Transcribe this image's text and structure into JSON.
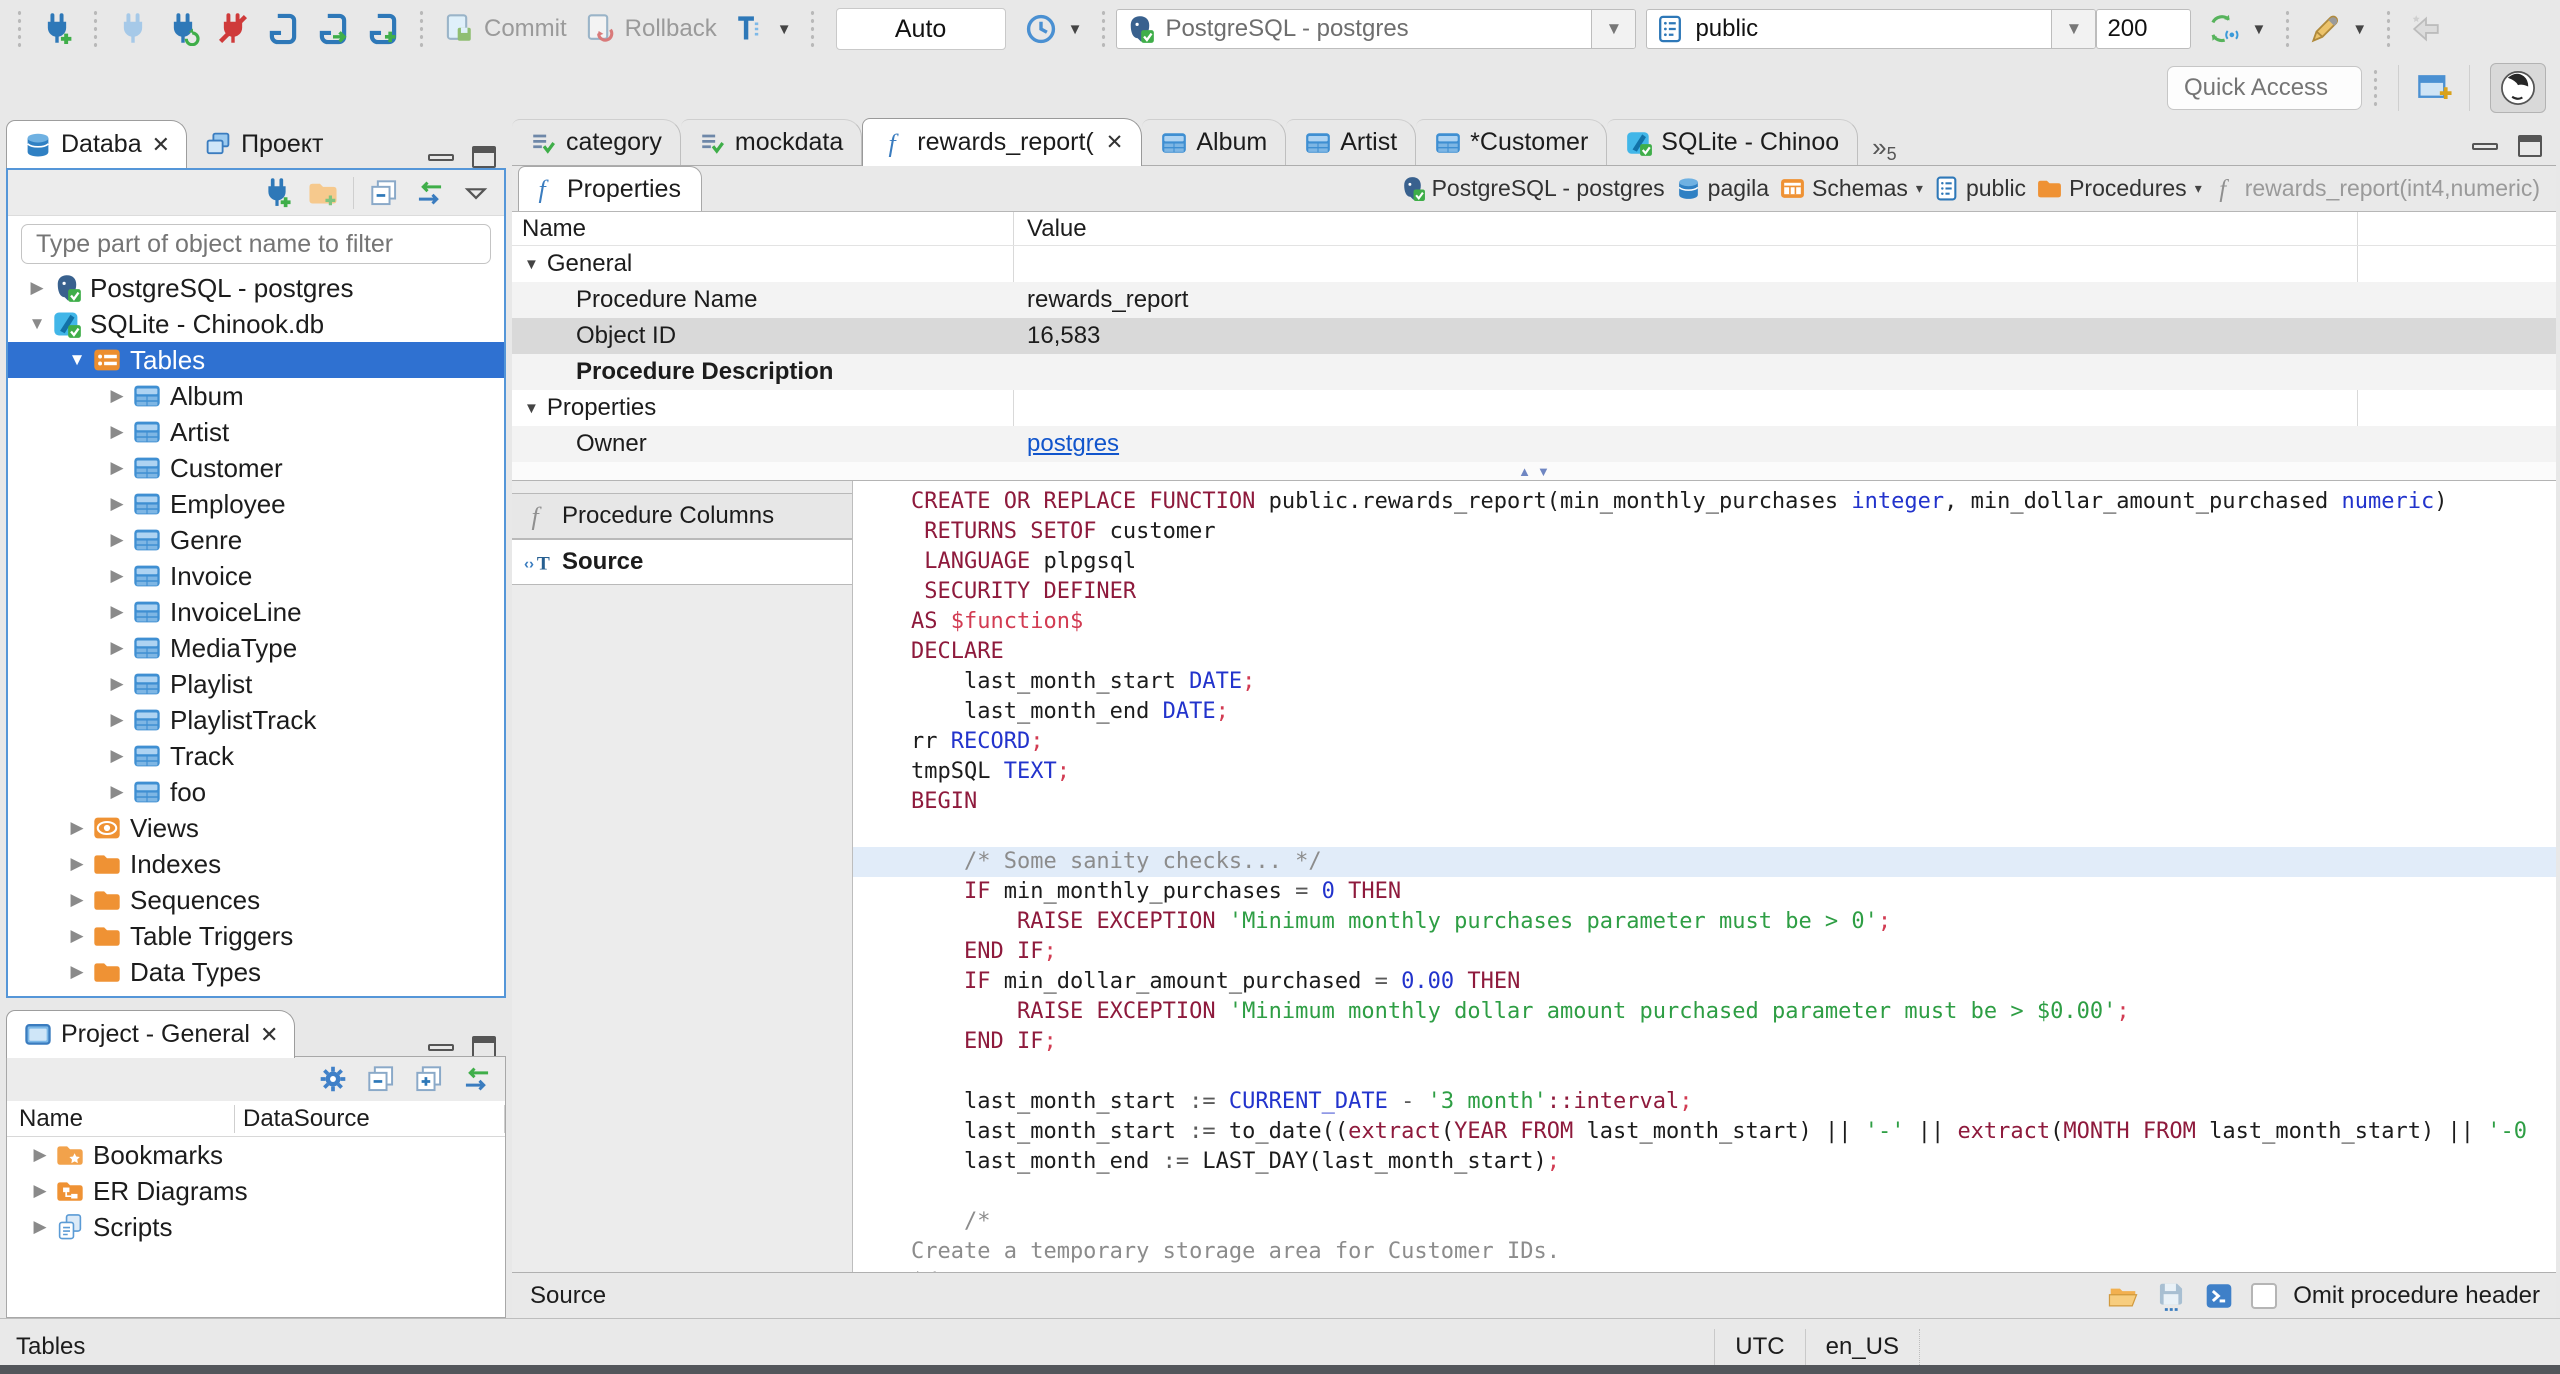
{
  "toolbar": {
    "commit": "Commit",
    "rollback": "Rollback",
    "auto": "Auto",
    "connection": "PostgreSQL - postgres",
    "schema": "public",
    "fetch_size": "200",
    "quick_access": "Quick Access"
  },
  "nav_panel": {
    "tabs": [
      {
        "label": "Databa",
        "icon": "db",
        "active": true,
        "close": true
      },
      {
        "label": "Проект",
        "icon": "windows"
      }
    ],
    "filter_placeholder": "Type part of object name to filter",
    "tree": [
      {
        "label": "PostgreSQL - postgres",
        "icon": "postgres",
        "indent": 0,
        "arrow": "collapsed"
      },
      {
        "label": "SQLite - Chinook.db",
        "icon": "sqlite",
        "indent": 0,
        "arrow": "expanded"
      },
      {
        "label": "Tables",
        "icon": "tables",
        "indent": 1,
        "arrow": "expanded",
        "selected": true
      },
      {
        "label": "Album",
        "icon": "table",
        "indent": 2,
        "arrow": "collapsed"
      },
      {
        "label": "Artist",
        "icon": "table",
        "indent": 2,
        "arrow": "collapsed"
      },
      {
        "label": "Customer",
        "icon": "table",
        "indent": 2,
        "arrow": "collapsed"
      },
      {
        "label": "Employee",
        "icon": "table",
        "indent": 2,
        "arrow": "collapsed"
      },
      {
        "label": "Genre",
        "icon": "table",
        "indent": 2,
        "arrow": "collapsed"
      },
      {
        "label": "Invoice",
        "icon": "table",
        "indent": 2,
        "arrow": "collapsed"
      },
      {
        "label": "InvoiceLine",
        "icon": "table",
        "indent": 2,
        "arrow": "collapsed"
      },
      {
        "label": "MediaType",
        "icon": "table",
        "indent": 2,
        "arrow": "collapsed"
      },
      {
        "label": "Playlist",
        "icon": "table",
        "indent": 2,
        "arrow": "collapsed"
      },
      {
        "label": "PlaylistTrack",
        "icon": "table",
        "indent": 2,
        "arrow": "collapsed"
      },
      {
        "label": "Track",
        "icon": "table",
        "indent": 2,
        "arrow": "collapsed"
      },
      {
        "label": "foo",
        "icon": "table",
        "indent": 2,
        "arrow": "collapsed"
      },
      {
        "label": "Views",
        "icon": "views",
        "indent": 1,
        "arrow": "collapsed"
      },
      {
        "label": "Indexes",
        "icon": "folder",
        "indent": 1,
        "arrow": "collapsed"
      },
      {
        "label": "Sequences",
        "icon": "folder",
        "indent": 1,
        "arrow": "collapsed"
      },
      {
        "label": "Table Triggers",
        "icon": "folder",
        "indent": 1,
        "arrow": "collapsed"
      },
      {
        "label": "Data Types",
        "icon": "folder",
        "indent": 1,
        "arrow": "collapsed"
      }
    ]
  },
  "project_panel": {
    "title": "Project - General",
    "columns": [
      "Name",
      "DataSource"
    ],
    "tree": [
      {
        "label": "Bookmarks",
        "icon": "bookmarks"
      },
      {
        "label": "ER Diagrams",
        "icon": "erd"
      },
      {
        "label": "Scripts",
        "icon": "scripts"
      }
    ]
  },
  "editor_tabs": [
    {
      "label": "category",
      "icon": "sqlscript"
    },
    {
      "label": "mockdata",
      "icon": "sqlscript"
    },
    {
      "label": "rewards_report(",
      "icon": "fn",
      "active": true,
      "close": true
    },
    {
      "label": "Album",
      "icon": "table"
    },
    {
      "label": "Artist",
      "icon": "table"
    },
    {
      "label": "*Customer",
      "icon": "table"
    },
    {
      "label": "SQLite - Chinoo",
      "icon": "sqlite"
    }
  ],
  "tab_overflow": "5",
  "properties": {
    "tab": "Properties",
    "breadcrumb": [
      {
        "label": "PostgreSQL - postgres",
        "icon": "postgres"
      },
      {
        "label": "pagila",
        "icon": "db"
      },
      {
        "label": "Schemas",
        "icon": "schemas",
        "dropdown": true
      },
      {
        "label": "public",
        "icon": "schema"
      },
      {
        "label": "Procedures",
        "icon": "folder",
        "dropdown": true
      },
      {
        "label": "rewards_report(int4,numeric)",
        "icon": "fngray",
        "muted": true
      }
    ],
    "columns": [
      "Name",
      "Value"
    ],
    "rows": [
      {
        "name": "General",
        "group": true
      },
      {
        "name": "Procedure Name",
        "value": "rewards_report"
      },
      {
        "name": "Object ID",
        "value": "16,583",
        "selected": true
      },
      {
        "name": "Procedure Description",
        "bold": true
      },
      {
        "name": "Properties",
        "group": true
      },
      {
        "name": "Owner",
        "value": "postgres",
        "link": true
      }
    ],
    "subtabs": [
      {
        "label": "Procedure Columns",
        "icon": "fngray"
      },
      {
        "label": "Source",
        "icon": "source",
        "active": true
      }
    ],
    "status": "Source",
    "omit_label": "Omit procedure header"
  },
  "code": {
    "current_line": 12,
    "lines": [
      [
        [
          "k",
          "CREATE OR REPLACE FUNCTION"
        ],
        [
          "i",
          " public.rewards_report(min_monthly_purchases "
        ],
        [
          "t",
          "integer"
        ],
        [
          "i",
          ", min_dollar_amount_purchased "
        ],
        [
          "t",
          "numeric"
        ],
        [
          "i",
          ")"
        ]
      ],
      [
        [
          "i",
          " "
        ],
        [
          "k",
          "RETURNS SETOF"
        ],
        [
          "i",
          " customer"
        ]
      ],
      [
        [
          "i",
          " "
        ],
        [
          "k",
          "LANGUAGE"
        ],
        [
          "i",
          " plpgsql"
        ]
      ],
      [
        [
          "i",
          " "
        ],
        [
          "k",
          "SECURITY DEFINER"
        ]
      ],
      [
        [
          "k",
          "AS"
        ],
        [
          "i",
          " "
        ],
        [
          "d",
          "$function$"
        ]
      ],
      [
        [
          "k",
          "DECLARE"
        ]
      ],
      [
        [
          "i",
          "    last_month_start "
        ],
        [
          "t",
          "DATE"
        ],
        [
          "p",
          ";"
        ]
      ],
      [
        [
          "i",
          "    last_month_end "
        ],
        [
          "t",
          "DATE"
        ],
        [
          "p",
          ";"
        ]
      ],
      [
        [
          "i",
          "rr "
        ],
        [
          "t",
          "RECORD"
        ],
        [
          "p",
          ";"
        ]
      ],
      [
        [
          "i",
          "tmpSQL "
        ],
        [
          "t",
          "TEXT"
        ],
        [
          "p",
          ";"
        ]
      ],
      [
        [
          "k",
          "BEGIN"
        ]
      ],
      [],
      [
        [
          "i",
          "    "
        ],
        [
          "c",
          "/* Some sanity checks... */"
        ]
      ],
      [
        [
          "i",
          "    "
        ],
        [
          "k",
          "IF"
        ],
        [
          "i",
          " min_monthly_purchases "
        ],
        [
          "o",
          "="
        ],
        [
          "i",
          " "
        ],
        [
          "n",
          "0"
        ],
        [
          "i",
          " "
        ],
        [
          "k",
          "THEN"
        ]
      ],
      [
        [
          "i",
          "        "
        ],
        [
          "k",
          "RAISE EXCEPTION"
        ],
        [
          "i",
          " "
        ],
        [
          "s",
          "'Minimum monthly purchases parameter must be > 0'"
        ],
        [
          "p",
          ";"
        ]
      ],
      [
        [
          "i",
          "    "
        ],
        [
          "k",
          "END IF"
        ],
        [
          "p",
          ";"
        ]
      ],
      [
        [
          "i",
          "    "
        ],
        [
          "k",
          "IF"
        ],
        [
          "i",
          " min_dollar_amount_purchased "
        ],
        [
          "o",
          "="
        ],
        [
          "i",
          " "
        ],
        [
          "n",
          "0.00"
        ],
        [
          "i",
          " "
        ],
        [
          "k",
          "THEN"
        ]
      ],
      [
        [
          "i",
          "        "
        ],
        [
          "k",
          "RAISE EXCEPTION"
        ],
        [
          "i",
          " "
        ],
        [
          "s",
          "'Minimum monthly dollar amount purchased parameter must be > $0.00'"
        ],
        [
          "p",
          ";"
        ]
      ],
      [
        [
          "i",
          "    "
        ],
        [
          "k",
          "END IF"
        ],
        [
          "p",
          ";"
        ]
      ],
      [],
      [
        [
          "i",
          "    last_month_start "
        ],
        [
          "o",
          ":="
        ],
        [
          "i",
          " "
        ],
        [
          "t",
          "CURRENT_DATE"
        ],
        [
          "i",
          " "
        ],
        [
          "o",
          "-"
        ],
        [
          "i",
          " "
        ],
        [
          "s",
          "'3 month'"
        ],
        [
          "k",
          "::interval"
        ],
        [
          "p",
          ";"
        ]
      ],
      [
        [
          "i",
          "    last_month_start "
        ],
        [
          "o",
          ":="
        ],
        [
          "i",
          " to_date(("
        ],
        [
          "k",
          "extract"
        ],
        [
          "i",
          "("
        ],
        [
          "k",
          "YEAR FROM"
        ],
        [
          "i",
          " last_month_start) || "
        ],
        [
          "s",
          "'-'"
        ],
        [
          "i",
          " || "
        ],
        [
          "k",
          "extract"
        ],
        [
          "i",
          "("
        ],
        [
          "k",
          "MONTH FROM"
        ],
        [
          "i",
          " last_month_start) || "
        ],
        [
          "s",
          "'-0"
        ]
      ],
      [
        [
          "i",
          "    last_month_end "
        ],
        [
          "o",
          ":="
        ],
        [
          "i",
          " LAST_DAY(last_month_start)"
        ],
        [
          "p",
          ";"
        ]
      ],
      [],
      [
        [
          "c",
          "    /*"
        ]
      ],
      [
        [
          "c",
          "Create a temporary storage area for Customer IDs."
        ]
      ],
      [
        [
          "c",
          "*/"
        ]
      ]
    ]
  },
  "statusbar": {
    "left": "Tables",
    "timezone": "UTC",
    "locale": "en_US"
  }
}
